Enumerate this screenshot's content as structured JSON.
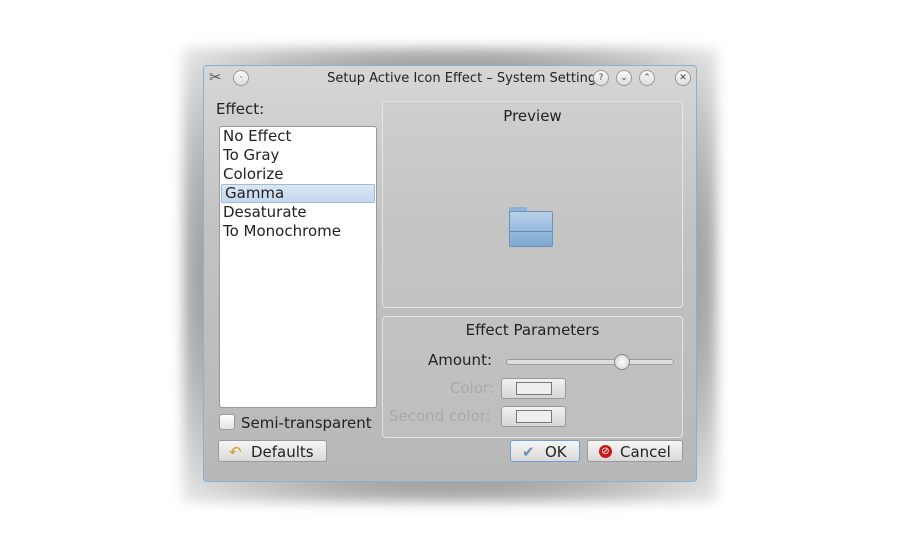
{
  "window": {
    "title": "Setup Active Icon Effect – System Settings",
    "help": "?",
    "minimize": "⌄",
    "maximize": "⌃",
    "close": "✕"
  },
  "effect": {
    "label": "Effect:",
    "items": [
      "No Effect",
      "To Gray",
      "Colorize",
      "Gamma",
      "Desaturate",
      "To Monochrome"
    ],
    "selected": "Gamma"
  },
  "preview": {
    "title": "Preview",
    "icon": "folder-icon"
  },
  "params": {
    "title": "Effect Parameters",
    "amount_label": "Amount:",
    "amount_value": 0.69,
    "color_label": "Color:",
    "second_color_label": "Second color:",
    "color": "#eeeeee",
    "second_color": "#eeeeee"
  },
  "semi_transparent": {
    "label": "Semi-transparent",
    "checked": false
  },
  "buttons": {
    "defaults": "Defaults",
    "ok": "OK",
    "cancel": "Cancel"
  }
}
